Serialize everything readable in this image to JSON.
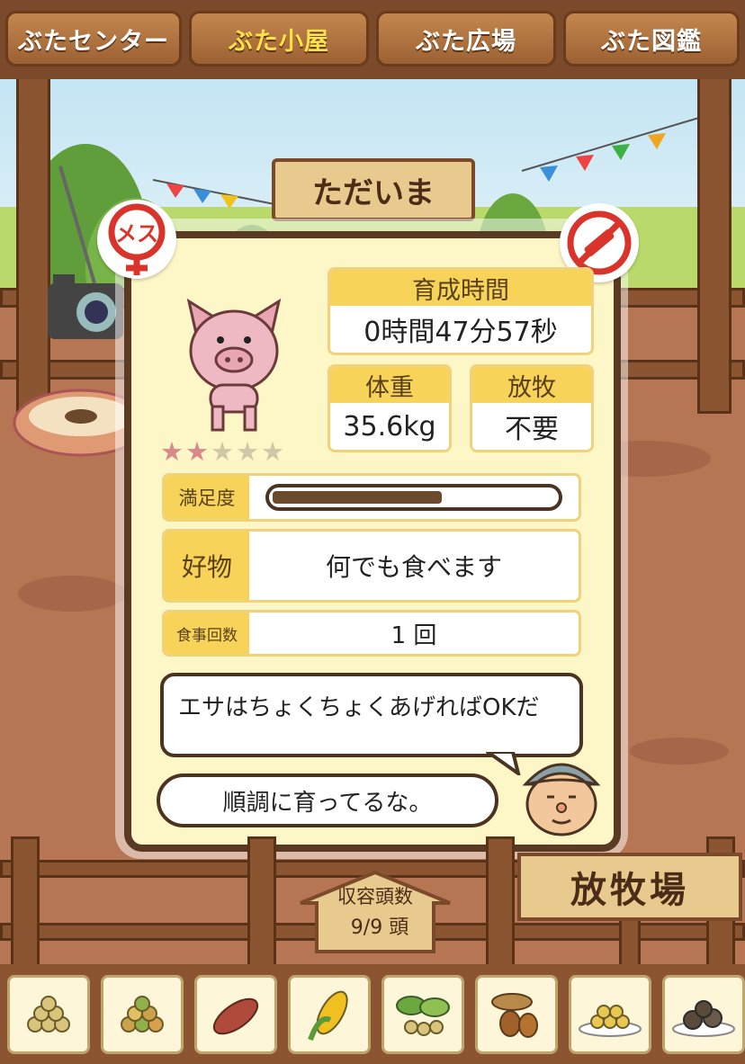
{
  "tabs": [
    {
      "label": "ぶたセンター",
      "active": false
    },
    {
      "label": "ぶた小屋",
      "active": true
    },
    {
      "label": "ぶた広場",
      "active": false
    },
    {
      "label": "ぶた図鑑",
      "active": false
    }
  ],
  "welcome_sign": "ただいま",
  "pig": {
    "gender_badge": "メス",
    "vaccine_icon": "syringe-prohibited-icon",
    "rating_stars": 2,
    "rating_max": 5
  },
  "stats": {
    "raise_time_label": "育成時間",
    "raise_time_value": "0時間47分57秒",
    "weight_label": "体重",
    "weight_value": "35.6kg",
    "grazing_label": "放牧",
    "grazing_value": "不要",
    "satisfaction_label": "満足度",
    "satisfaction_level": 0.6,
    "favorite_label": "好物",
    "favorite_value": "何でも食べます",
    "meals_label": "食事回数",
    "meals_value": "1 回"
  },
  "farmer": {
    "hint_bubble": "エサはちょくちょくあげればOKだ",
    "comment_bubble": "順調に育ってるな。"
  },
  "capacity": {
    "label": "収容頭数",
    "value": "9/9 頭"
  },
  "ranch_sign": "放牧場",
  "foods": [
    {
      "icon": "soybeans-icon"
    },
    {
      "icon": "mixed-grain-icon"
    },
    {
      "icon": "sweet-potato-icon"
    },
    {
      "icon": "corn-icon"
    },
    {
      "icon": "greens-nuts-icon"
    },
    {
      "icon": "acorn-icon"
    },
    {
      "icon": "grain-plate-icon"
    },
    {
      "icon": "meat-plate-icon"
    }
  ],
  "colors": {
    "accent_yellow": "#f7d35a",
    "panel_bg": "#fdf6c6",
    "wood_brown": "#8a5530",
    "tab_active_text": "#ffe24a",
    "badge_red": "#d9342b"
  }
}
